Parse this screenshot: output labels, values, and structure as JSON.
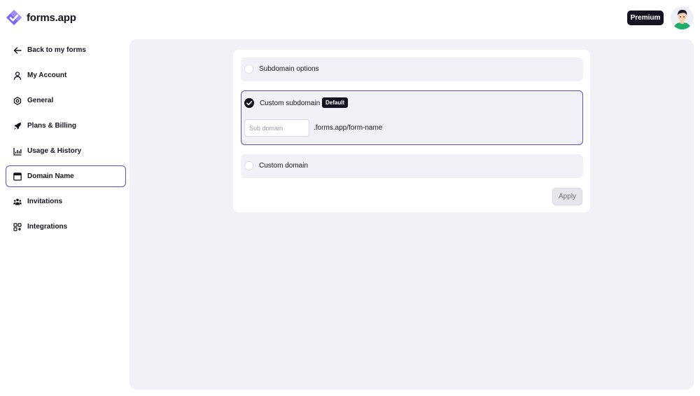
{
  "header": {
    "logo_text": "forms.app",
    "premium_label": "Premium",
    "brand_color": "#6c5ce7"
  },
  "sidebar": {
    "items": [
      {
        "label": "Back to my forms",
        "icon": "arrow-left-icon"
      },
      {
        "label": "My Account",
        "icon": "user-icon"
      },
      {
        "label": "General",
        "icon": "gear-icon"
      },
      {
        "label": "Plans & Billing",
        "icon": "rocket-icon"
      },
      {
        "label": "Usage & History",
        "icon": "bar-chart-icon"
      },
      {
        "label": "Domain Name",
        "icon": "browser-window-icon",
        "active": true
      },
      {
        "label": "Invitations",
        "icon": "users-icon"
      },
      {
        "label": "Integrations",
        "icon": "grid-icon"
      }
    ]
  },
  "domain": {
    "options": [
      {
        "label": "Subdomain options",
        "selected": false
      },
      {
        "label": "Custom subdomain",
        "selected": true,
        "badge": "Default"
      },
      {
        "label": "Custom domain",
        "selected": false
      }
    ],
    "subdomain_input": {
      "placeholder": "Sub domain",
      "value": ""
    },
    "suffix": ".forms.app/form-name",
    "apply_label": "Apply"
  }
}
